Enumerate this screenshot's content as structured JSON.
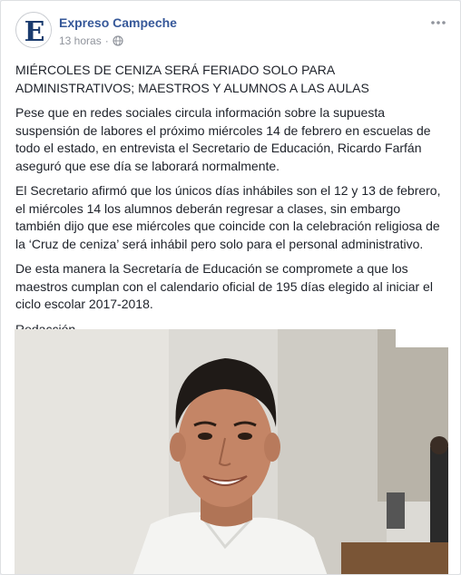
{
  "post": {
    "page_name": "Expreso Campeche",
    "timestamp": "13 horas",
    "separator": "·",
    "headline": "MIÉRCOLES DE CENIZA SERÁ FERIADO SOLO PARA ADMINISTRATIVOS; MAESTROS Y ALUMNOS A LAS AULAS",
    "paragraphs": [
      "Pese que en redes sociales circula información sobre la supuesta suspensión de labores el próximo miércoles 14 de febrero en escuelas de todo el estado, en entrevista el Secretario de Educación, Ricardo Farfán aseguró que ese día se laborará normalmente.",
      "El Secretario afirmó que los únicos días inhábiles son el 12 y 13 de febrero, el miércoles 14 los alumnos deberán regresar a clases, sin embargo también dijo que ese miércoles que coincide con la celebración religiosa de la ‘Cruz de ceniza’ será inhábil pero solo para el personal administrativo.",
      "De esta manera la Secretaría de Educación se compromete a que los maestros cumplan con el calendario oficial de 195 días elegido al iniciar el ciclo escolar 2017-2018.",
      "Redacción."
    ],
    "avatar_letter": "E",
    "icons": {
      "privacy": "globe-icon",
      "menu": "more-options-icon"
    },
    "colors": {
      "link": "#365899",
      "meta": "#90949c",
      "text": "#1d2129",
      "avatar_blue": "#1a3b6e"
    }
  }
}
